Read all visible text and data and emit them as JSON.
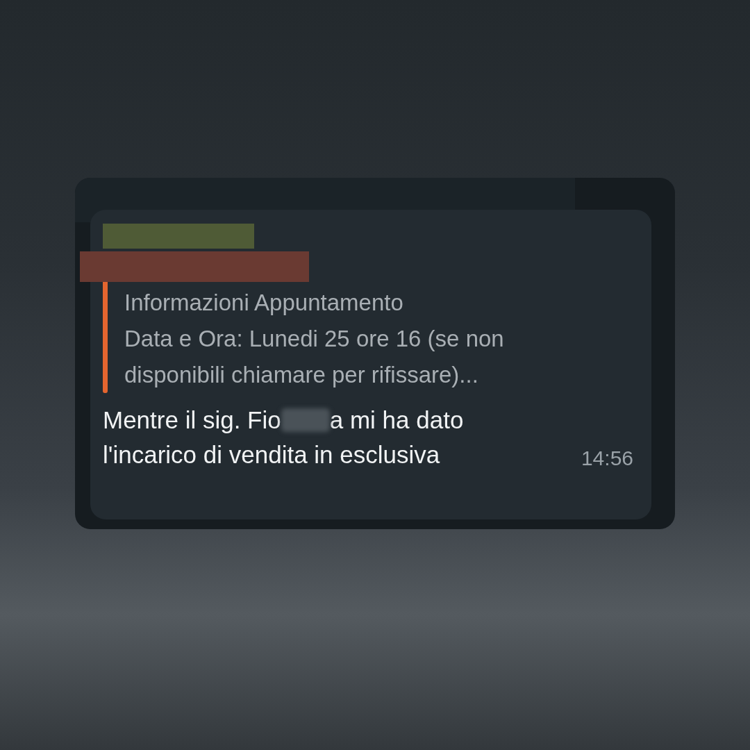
{
  "message": {
    "quote": {
      "lines": [
        "Informazioni Appuntamento",
        "Data e Ora: Lunedi 25 ore 16 (se non",
        "disponibili chiamare per rifissare)..."
      ]
    },
    "text_start": "Mentre il sig. Fio",
    "text_after_redaction": "a mi ha dato",
    "text_line_2": "l'incarico di vendita in esclusiva",
    "time": "14:56"
  }
}
